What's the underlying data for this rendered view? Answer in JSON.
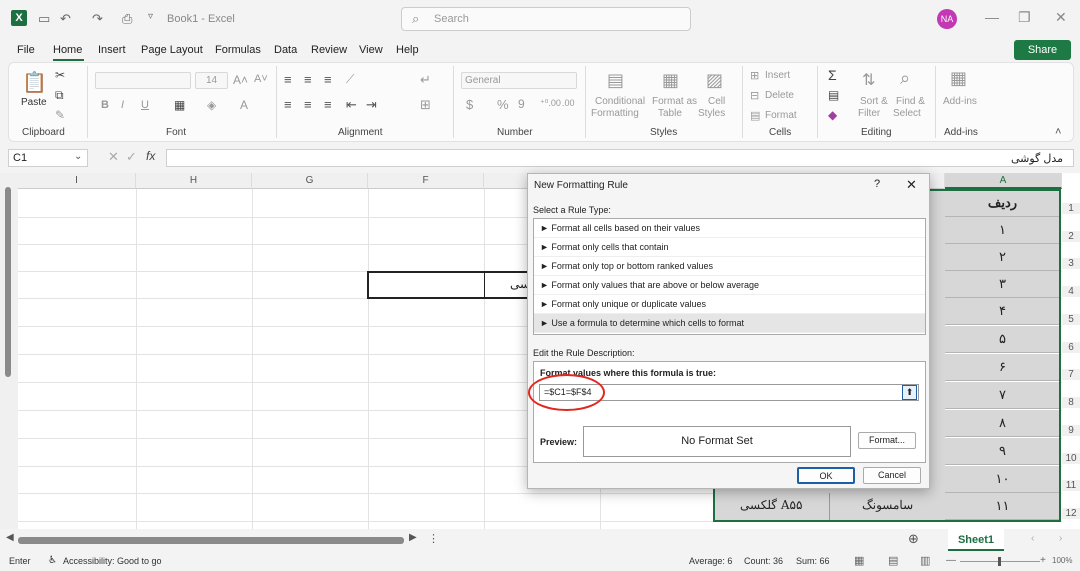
{
  "titlebar": {
    "doc_title": "Book1 - Excel",
    "search_placeholder": "Search",
    "avatar": "NA"
  },
  "menu": {
    "tabs": [
      "File",
      "Home",
      "Insert",
      "Page Layout",
      "Formulas",
      "Data",
      "Review",
      "View",
      "Help"
    ],
    "share": "Share"
  },
  "ribbon": {
    "paste": "Paste",
    "font_size": "14",
    "number_format": "General",
    "conditional": "Conditional",
    "formatting": "Formatting",
    "format_as": "Format as",
    "table": "Table",
    "cell": "Cell",
    "styles_btn": "Styles",
    "insert": "Insert",
    "delete": "Delete",
    "format": "Format",
    "sort": "Sort &",
    "filter": "Filter",
    "find": "Find &",
    "select": "Select",
    "addins_btn": "Add-ins",
    "groups": [
      "Clipboard",
      "Font",
      "Alignment",
      "Number",
      "Styles",
      "Cells",
      "Editing",
      "Add-ins"
    ]
  },
  "formula_bar": {
    "name_box": "C1",
    "content": "مدل گوشی"
  },
  "grid": {
    "columns": [
      "I",
      "H",
      "G",
      "F",
      "A"
    ],
    "rows": [
      "1",
      "2",
      "3",
      "4",
      "5",
      "6",
      "7",
      "8",
      "9",
      "10",
      "11",
      "12"
    ],
    "colA": [
      "ردیف",
      "۱",
      "۲",
      "۳",
      "۴",
      "۵",
      "۶",
      "۷",
      "۸",
      "۹",
      "۱۰",
      "۱۱"
    ],
    "f_partial": "سی",
    "row11_b": "سامسونگ",
    "row11_c": "گلکسی A۵۵"
  },
  "dialog": {
    "title": "New Formatting Rule",
    "help": "?",
    "select_type": "Select a Rule Type:",
    "rules": [
      "► Format all cells based on their values",
      "► Format only cells that contain",
      "► Format only top or bottom ranked values",
      "► Format only values that are above or below average",
      "► Format only unique or duplicate values",
      "► Use a formula to determine which cells to format"
    ],
    "edit_desc": "Edit the Rule Description:",
    "format_values": "Format values where this formula is true:",
    "formula": "=$C1=$F$4",
    "preview_label": "Preview:",
    "preview_text": "No Format Set",
    "format_btn": "Format...",
    "ok": "OK",
    "cancel": "Cancel"
  },
  "sheet": {
    "name": "Sheet1"
  },
  "status": {
    "mode": "Enter",
    "accessibility": "Accessibility: Good to go",
    "average": "Average: 6",
    "count": "Count: 36",
    "sum": "Sum: 66",
    "zoom": "100%"
  }
}
